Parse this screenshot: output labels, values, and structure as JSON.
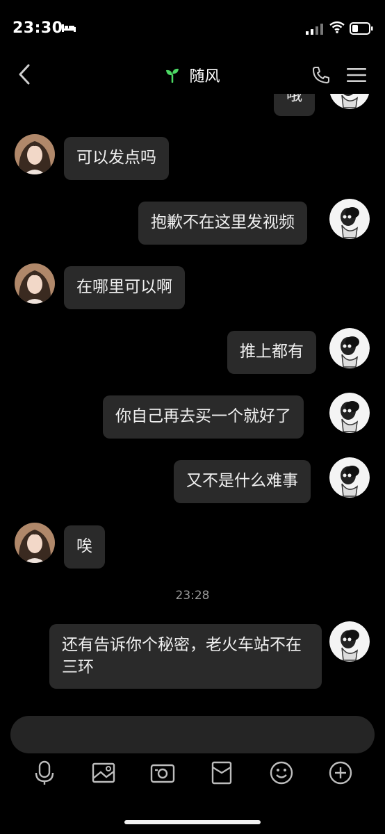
{
  "status_bar": {
    "time": "23:30"
  },
  "header": {
    "title": "随风",
    "icons": [
      "back-icon",
      "sprout-icon",
      "phone-icon",
      "menu-icon"
    ]
  },
  "messages": [
    {
      "sender": "me",
      "text": "哦"
    },
    {
      "sender": "other",
      "text": "可以发点吗"
    },
    {
      "sender": "me",
      "text": "抱歉不在这里发视频"
    },
    {
      "sender": "other",
      "text": "在哪里可以啊"
    },
    {
      "sender": "me",
      "text": "推上都有"
    },
    {
      "sender": "me",
      "text": "你自己再去买一个就好了"
    },
    {
      "sender": "me",
      "text": "又不是什么难事"
    },
    {
      "sender": "other",
      "text": "唉"
    },
    {
      "sender": "me",
      "text": "还有告诉你个秘密，老火车站不在三环"
    }
  ],
  "timestamp": "23:28",
  "toolbar": {
    "icons": [
      "microphone-icon",
      "image-icon",
      "camera-icon",
      "red-packet-icon",
      "emoji-icon",
      "add-icon"
    ]
  },
  "colors": {
    "background": "#000000",
    "bubble": "#2a2a2a",
    "input": "#252525",
    "accent": "#4cd964"
  }
}
